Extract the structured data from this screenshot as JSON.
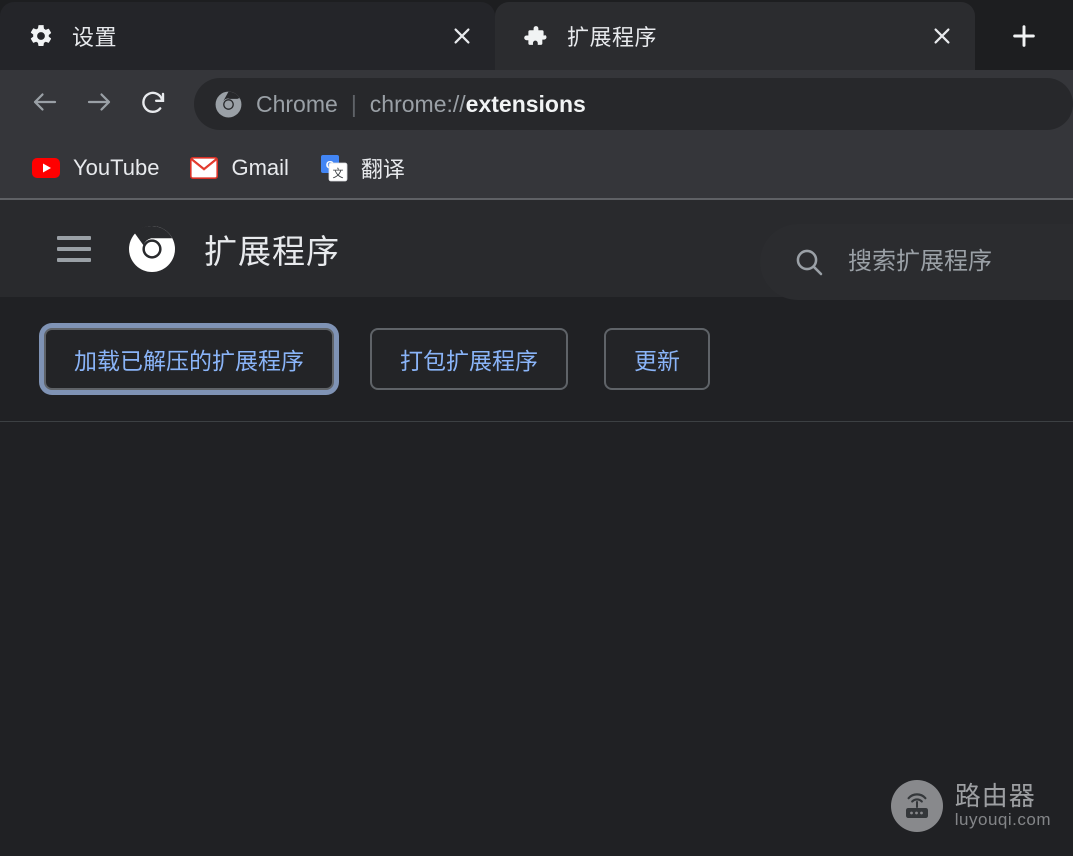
{
  "browser": {
    "tabs": [
      {
        "title": "设置",
        "icon": "gear-icon",
        "active": false,
        "close_label": "×"
      },
      {
        "title": "扩展程序",
        "icon": "puzzle-piece-icon",
        "active": true,
        "close_label": "×"
      }
    ],
    "new_tab_label": "+",
    "nav": {
      "back_icon": "arrow-left-icon",
      "forward_icon": "arrow-right-icon",
      "reload_icon": "reload-icon"
    },
    "omnibox": {
      "favicon": "chrome-logo-icon",
      "scheme_label": "Chrome",
      "separator": "|",
      "url_prefix": "chrome://",
      "url_highlight": "extensions"
    },
    "bookmarks": [
      {
        "label": "YouTube",
        "icon": "youtube-icon"
      },
      {
        "label": "Gmail",
        "icon": "gmail-icon"
      },
      {
        "label": "翻译",
        "icon": "google-translate-icon"
      }
    ]
  },
  "extensions_page": {
    "menu_icon": "hamburger-menu-icon",
    "logo_icon": "chrome-logo-icon",
    "title": "扩展程序",
    "search": {
      "icon": "search-icon",
      "placeholder": "搜索扩展程序",
      "value": ""
    },
    "actions": [
      {
        "label": "加载已解压的扩展程序",
        "focused": true
      },
      {
        "label": "打包扩展程序",
        "focused": false
      },
      {
        "label": "更新",
        "focused": false
      }
    ],
    "empty_list": ""
  },
  "watermark": {
    "icon": "router-icon",
    "name": "路由器",
    "url": "luyouqi.com"
  },
  "colors": {
    "accent_blue": "#8ab4f8",
    "tabstrip_bg": "#1d1e20",
    "toolbar_bg": "#35363a",
    "page_bg": "#202124",
    "header_bg": "#292a2d",
    "text_primary": "#e8eaed",
    "text_secondary": "#9aa0a6"
  }
}
